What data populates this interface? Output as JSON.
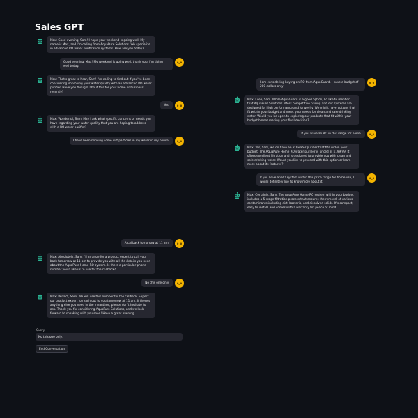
{
  "app": {
    "title": "Sales GPT"
  },
  "avatars": {
    "bot_icon": "robot-icon",
    "user_icon": "face-icon",
    "user_glyph": "ʘ‿ʘ",
    "bot_color": "#2bb594",
    "user_color": "#f4b400"
  },
  "conversation_left": [
    {
      "role": "bot",
      "text": "Max: Good evening, Sam! I hope your weekend is going well. My name is Max, and I'm calling from AquaPure Solutions. We specialize in advanced RO water purification systems. How are you today?"
    },
    {
      "role": "user",
      "text": "Good evening, Max! My weekend is going well, thank you. I'm doing well today."
    },
    {
      "role": "bot",
      "text": "Max: That's great to hear, Sam! I'm calling to find out if you've been considering improving your water quality with an advanced RO water purifier. Have you thought about this for your home or business recently?"
    },
    {
      "role": "user",
      "text": "Yes."
    },
    {
      "role": "bot",
      "text": "Max: Wonderful, Sam. May I ask what specific concerns or needs you have regarding your water quality that you are hoping to address with a RO water purifier?"
    },
    {
      "role": "user",
      "text": "I have been noticing some dirt particles in my water in my house."
    }
  ],
  "conversation_right": [
    {
      "role": "user",
      "text": "I am considering buying an RO from AquaGuard. I have a budget of 200 dollars only"
    },
    {
      "role": "bot",
      "text": "Max: I see, Sam. While AquaGuard is a good option, I'd like to mention that AquaPure Solutions offers competitive pricing and our systems are designed for high performance and longevity. We might have options that fit within your budget and meet your needs for clean and safe drinking water. Would you be open to exploring our products that fit within your budget before making your final decision?"
    },
    {
      "role": "user",
      "text": "If you have an RO in this range for home."
    },
    {
      "role": "bot",
      "text": "Max: Yes, Sam, we do have an RO water purifier that fits within your budget. The AquaPure Home RO water purifier is priced at $199.99. It offers excellent filtration and is designed to provide you with clean and safe drinking water. Would you like to proceed with this option or learn more about its features?"
    },
    {
      "role": "user",
      "text": "If you have an RO system within this price range for home use, I would definitely like to know more about it."
    },
    {
      "role": "bot",
      "text": "Max: Certainly, Sam. The AquaPure Home RO system within your budget includes a 5-stage filtration process that ensures the removal of various contaminants including dirt, bacteria, and dissolved solids. It's compact, easy to install, and comes with a warranty for peace of mind."
    }
  ],
  "ellipsis": "...",
  "conversation_bottom": [
    {
      "role": "user",
      "text": "A callback tomorrow at 11 am."
    },
    {
      "role": "bot",
      "text": "Max: Absolutely, Sam. I'll arrange for a product expert to call you back tomorrow at 11 am to provide you with all the details you need about the AquaPure Home RO system. Is there a particular phone number you'd like us to use for the callback?"
    },
    {
      "role": "user",
      "text": "No this one only."
    },
    {
      "role": "bot",
      "text": "Max: Perfect, Sam. We will use this number for the callback. Expect our product expert to reach out to you tomorrow at 11 am. If there's anything else you need in the meantime, please don't hesitate to ask. Thank you for considering AquaPure Solutions, and we look forward to speaking with you soon! Have a great evening."
    }
  ],
  "query": {
    "label": "Query:",
    "value": "No this one only."
  },
  "end_button": {
    "label": "End Conversation"
  }
}
